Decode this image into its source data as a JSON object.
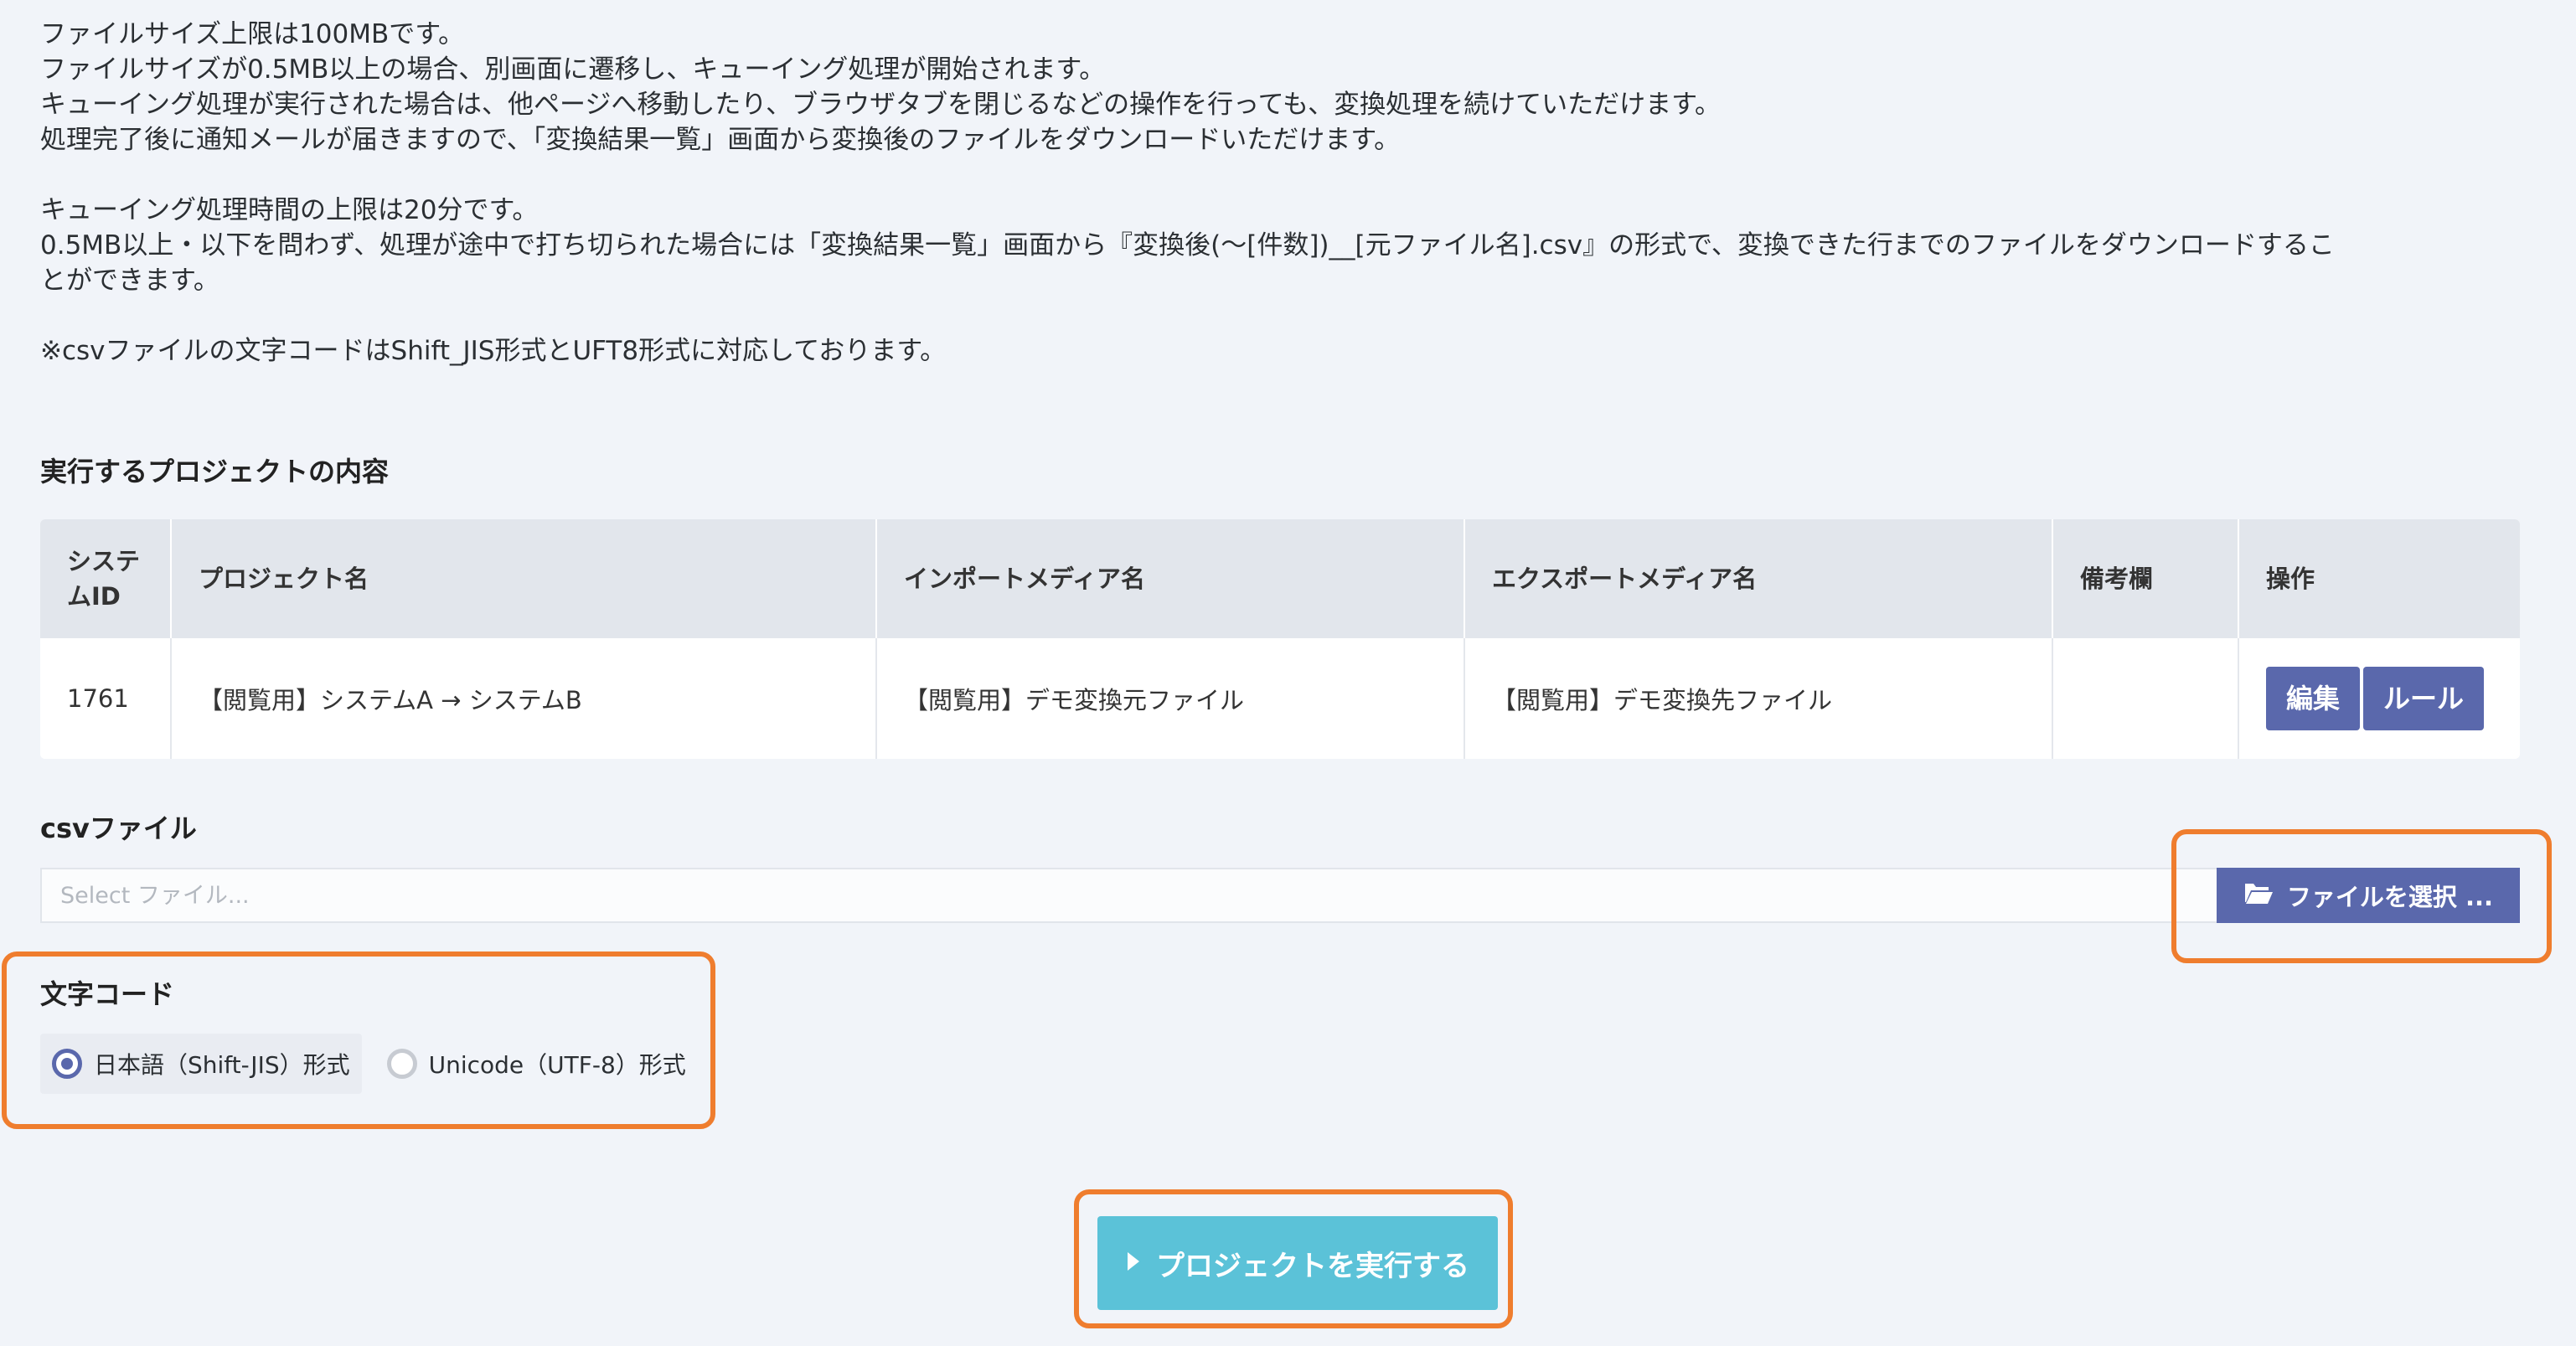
{
  "notes": [
    "ファイルサイズ上限は100MBです。",
    "ファイルサイズが0.5MB以上の場合、別画面に遷移し、キューイング処理が開始されます。",
    "キューイング処理が実行された場合は、他ページへ移動したり、ブラウザタブを閉じるなどの操作を行っても、変換処理を続けていただけます。",
    "処理完了後に通知メールが届きますので、「変換結果一覧」画面から変換後のファイルをダウンロードいただけます。",
    "キューイング処理時間の上限は20分です。",
    "0.5MB以上・以下を問わず、処理が途中で打ち切られた場合には「変換結果一覧」画面から『変換後(〜[件数])__[元ファイル名].csv』の形式で、変換できた行までのファイルをダウンロードするこ",
    "とができます。",
    "※csvファイルの文字コードはShift_JIS形式とUFT8形式に対応しております。"
  ],
  "project_section": {
    "title": "実行するプロジェクトの内容",
    "columns": [
      "システムID",
      "プロジェクト名",
      "インポートメディア名",
      "エクスポートメディア名",
      "備考欄",
      "操作"
    ],
    "row": {
      "system_id": "1761",
      "project_name": "【閲覧用】システムA → システムB",
      "import_media": "【閲覧用】デモ変換元ファイル",
      "export_media": "【閲覧用】デモ変換先ファイル",
      "remarks": "",
      "edit_label": "編集",
      "rule_label": "ルール"
    }
  },
  "csv_section": {
    "title": "csvファイル",
    "placeholder": "Select ファイル...",
    "select_button_label": "ファイルを選択 ...",
    "button_icon": "folder-open-icon"
  },
  "encoding_section": {
    "title": "文字コード",
    "options": [
      {
        "label": "日本語（Shift-JIS）形式",
        "selected": true
      },
      {
        "label": "Unicode（UTF-8）形式",
        "selected": false
      }
    ]
  },
  "execute": {
    "label": "プロジェクトを実行する",
    "icon": "play-icon"
  },
  "colors": {
    "accent": "#5a68ac",
    "execute": "#5bc2d8",
    "highlight": "#ef7d2e",
    "background": "#f1f4f9"
  }
}
